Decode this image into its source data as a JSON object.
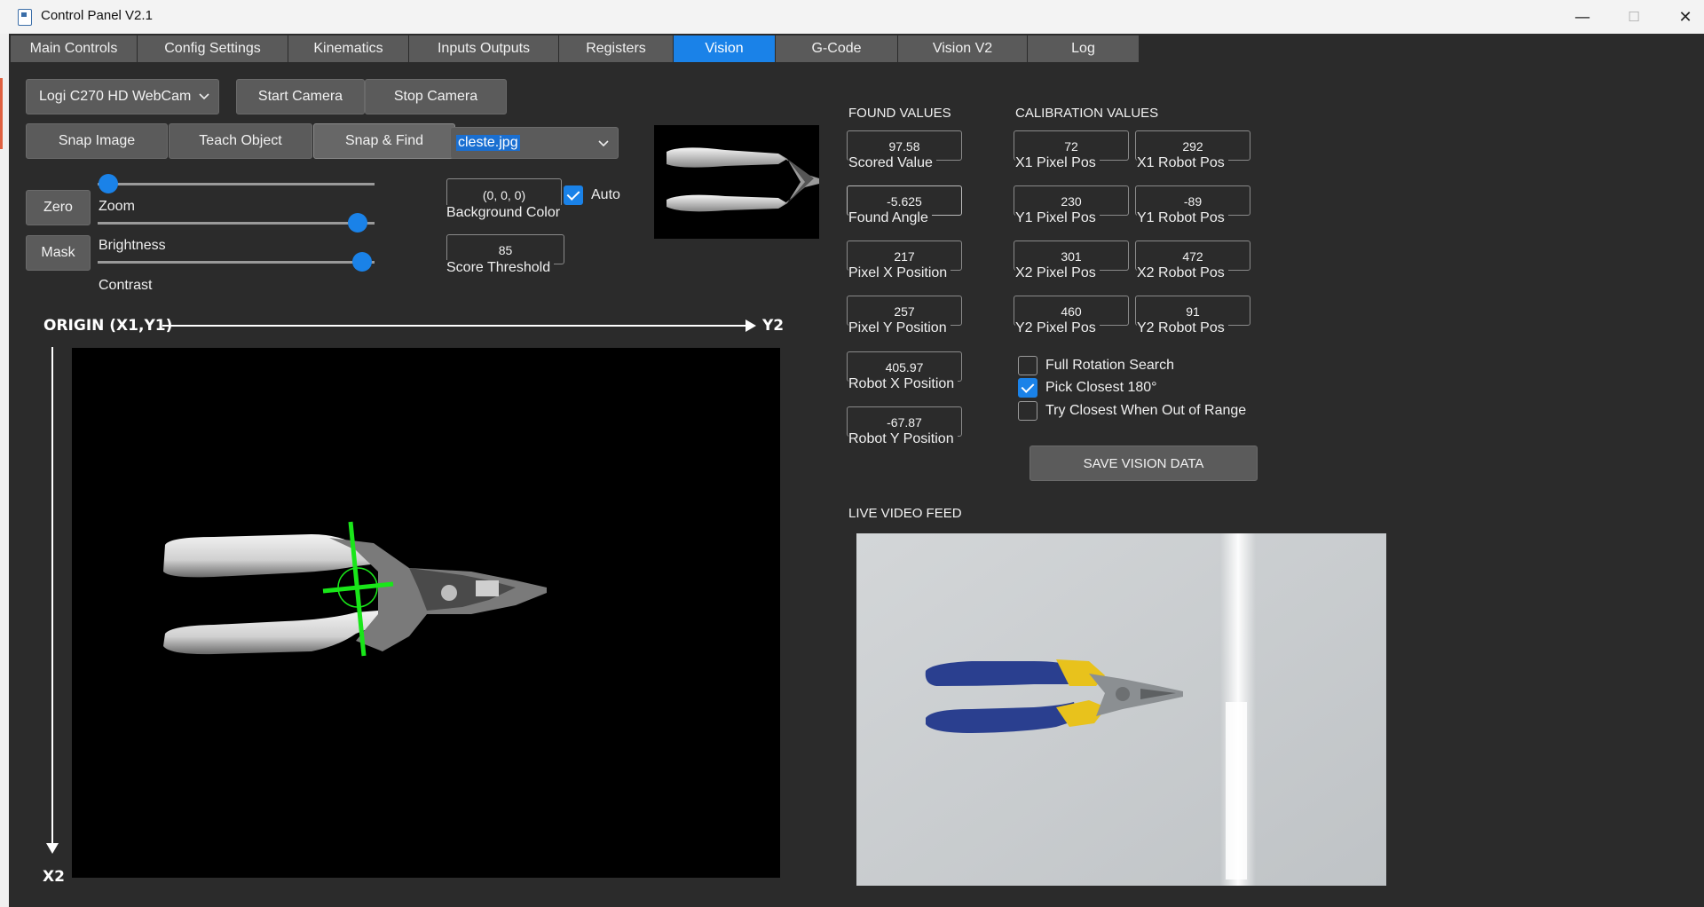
{
  "window": {
    "title": "Control Panel V2.1",
    "controls": {
      "minimize": "—",
      "maximize": "☐",
      "close": "✕"
    }
  },
  "tabs": [
    {
      "label": "Main Controls",
      "active": false
    },
    {
      "label": "Config Settings",
      "active": false
    },
    {
      "label": "Kinematics",
      "active": false
    },
    {
      "label": "Inputs Outputs",
      "active": false
    },
    {
      "label": "Registers",
      "active": false
    },
    {
      "label": "Vision",
      "active": true
    },
    {
      "label": "G-Code",
      "active": false
    },
    {
      "label": "Vision V2",
      "active": false
    },
    {
      "label": "Log",
      "active": false
    }
  ],
  "camera": {
    "selected": "Logi C270 HD WebCam",
    "start_label": "Start Camera",
    "stop_label": "Stop Camera"
  },
  "actions": {
    "snap_label": "Snap Image",
    "teach_label": "Teach Object",
    "snap_find_label": "Snap & Find",
    "template_file": "cleste.jpg"
  },
  "image_controls": {
    "zero_label": "Zero",
    "mask_label": "Mask",
    "sliders": [
      {
        "label": "Zoom",
        "value": 0.0
      },
      {
        "label": "Brightness",
        "value": 0.95
      },
      {
        "label": "Contrast",
        "value": 0.95
      }
    ]
  },
  "settings": {
    "background_color_value": "(0, 0, 0)",
    "background_color_label": "Background Color",
    "auto_label": "Auto",
    "auto_checked": true,
    "score_threshold_value": "85",
    "score_threshold_label": "Score Threshold"
  },
  "origin": {
    "origin_label": "ORIGIN (X1,Y1)",
    "y2_label": "Y2",
    "x2_label": "X2"
  },
  "found_values": {
    "header": "FOUND VALUES",
    "items": [
      {
        "value": "97.58",
        "label": "Scored Value"
      },
      {
        "value": "-5.625",
        "label": "Found Angle"
      },
      {
        "value": "217",
        "label": "Pixel X Position"
      },
      {
        "value": "257",
        "label": "Pixel Y Position"
      },
      {
        "value": "405.97",
        "label": "Robot X Position"
      },
      {
        "value": "-67.87",
        "label": "Robot Y Position"
      }
    ]
  },
  "calibration_values": {
    "header": "CALIBRATION VALUES",
    "rows": [
      {
        "pixel_value": "72",
        "pixel_label": "X1 Pixel Pos",
        "robot_value": "292",
        "robot_label": "X1 Robot Pos"
      },
      {
        "pixel_value": "230",
        "pixel_label": "Y1 Pixel Pos",
        "robot_value": "-89",
        "robot_label": "Y1 Robot Pos"
      },
      {
        "pixel_value": "301",
        "pixel_label": "X2 Pixel Pos",
        "robot_value": "472",
        "robot_label": "X2 Robot Pos"
      },
      {
        "pixel_value": "460",
        "pixel_label": "Y2 Pixel Pos",
        "robot_value": "91",
        "robot_label": "Y2 Robot Pos"
      }
    ]
  },
  "options": [
    {
      "label": "Full Rotation Search",
      "checked": false
    },
    {
      "label": "Pick Closest 180°",
      "checked": true
    },
    {
      "label": "Try Closest When Out of Range",
      "checked": false
    }
  ],
  "save_label": "SAVE VISION DATA",
  "live_feed_header": "LIVE VIDEO FEED",
  "colors": {
    "accent": "#1a82e8",
    "background": "#2b2b2b",
    "button": "#5b5b5b",
    "match_marker": "#19e619",
    "handle_blue": "#2a3f8f",
    "handle_yellow": "#e8c21c"
  },
  "icons": {
    "dropdown": "chevron-down-icon",
    "app": "app-window-icon"
  }
}
